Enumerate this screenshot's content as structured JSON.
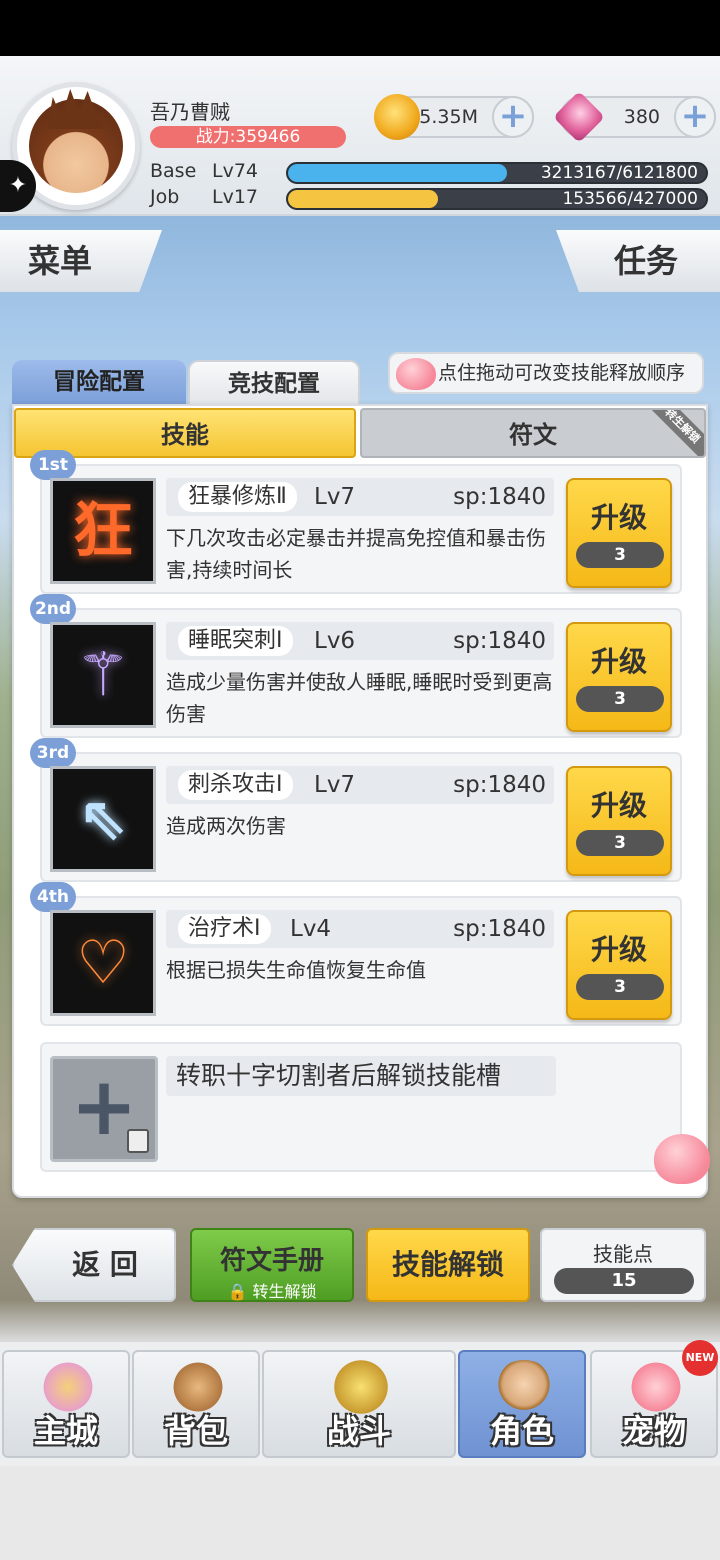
{
  "player": {
    "name": "吾乃曹贼",
    "power": "战力:359466",
    "base_label": "Base",
    "base_level": "Lv74",
    "base_exp": "3213167/6121800",
    "base_progress": 0.525,
    "job_label": "Job",
    "job_level": "Lv17",
    "job_exp": "153566/427000",
    "job_progress": 0.36
  },
  "currency": {
    "gold": "5.35M",
    "gems": "380",
    "plus": "+"
  },
  "menu_label": "菜单",
  "quest_label": "任务",
  "config_tabs": {
    "adventure": "冒险配置",
    "arena": "竞技配置"
  },
  "hint": "点住拖动可改变技能释放顺序",
  "sub_tabs": {
    "skills": "技能",
    "runes": "符文",
    "runes_badge": "转生解锁"
  },
  "skills": [
    {
      "rank": "1st",
      "name": "狂暴修炼Ⅱ",
      "level": "Lv7",
      "sp": "sp:1840",
      "desc": "下几次攻击必定暴击并提高免控值和暴击伤害,持续时间长",
      "upgrade": "升级",
      "cost": "3",
      "glyph": "狂",
      "color": "#ff6a2a"
    },
    {
      "rank": "2nd",
      "name": "睡眠突刺Ⅰ",
      "level": "Lv6",
      "sp": "sp:1840",
      "desc": "造成少量伤害并使敌人睡眠,睡眠时受到更高伤害",
      "upgrade": "升级",
      "cost": "3",
      "glyph": "⚚",
      "color": "#c7a8ff"
    },
    {
      "rank": "3rd",
      "name": "刺杀攻击Ⅰ",
      "level": "Lv7",
      "sp": "sp:1840",
      "desc": "造成两次伤害",
      "upgrade": "升级",
      "cost": "3",
      "glyph": "⇖",
      "color": "#bfe2ff"
    },
    {
      "rank": "4th",
      "name": "治疗术Ⅰ",
      "level": "Lv4",
      "sp": "sp:1840",
      "desc": "根据已损失生命值恢复生命值",
      "upgrade": "升级",
      "cost": "3",
      "glyph": "♡",
      "color": "#ff8a3a"
    }
  ],
  "locked_slot": "转职十字切割者后解锁技能槽",
  "footer": {
    "back": "返 回",
    "rune_manual": "符文手册",
    "rune_manual_sub": "转生解锁",
    "skill_unlock": "技能解锁",
    "skill_points_label": "技能点",
    "skill_points": "15"
  },
  "nav": [
    {
      "label": "主城",
      "active": false
    },
    {
      "label": "背包",
      "active": false
    },
    {
      "label": "战斗",
      "active": false
    },
    {
      "label": "角色",
      "active": true
    },
    {
      "label": "宠物",
      "active": false,
      "badge": "NEW"
    }
  ],
  "colors": {
    "accent_yellow": "#f5b817",
    "tab_blue": "#7c9fd8",
    "exp_blue": "#4ab3ee",
    "exp_yellow": "#f5c542",
    "power_red": "#f07070",
    "rune_green": "#5aa82e"
  }
}
